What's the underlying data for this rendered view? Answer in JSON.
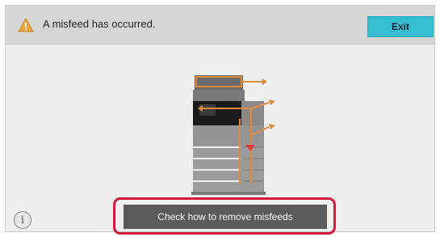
{
  "header": {
    "message": "A misfeed has occurred.",
    "exit_label": "Exit",
    "warning_icon": "warning-triangle-icon"
  },
  "main": {
    "illustration": "printer-misfeed-paper-path",
    "path_color": "#e08a3c",
    "arrow_color": "#e23b3b"
  },
  "footer": {
    "info_label": "i",
    "action_label": "Check how to remove misfeeds",
    "highlight_color": "#d21b3a"
  },
  "colors": {
    "accent": "#36bfd2",
    "button": "#5a5a5a"
  }
}
